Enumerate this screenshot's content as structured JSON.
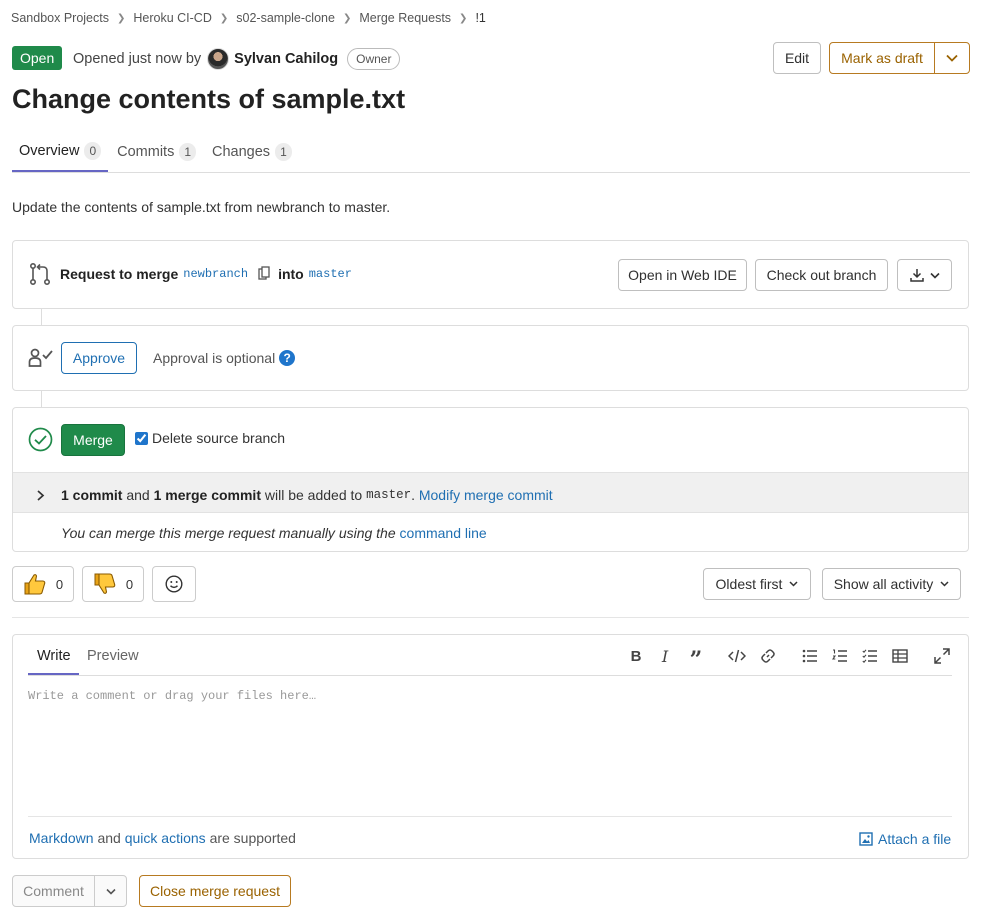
{
  "breadcrumb": [
    "Sandbox Projects",
    "Heroku CI-CD",
    "s02-sample-clone",
    "Merge Requests",
    "!1"
  ],
  "header": {
    "status": "Open",
    "opened_text": "Opened just now by",
    "author": "Sylvan Cahilog",
    "role_badge": "Owner",
    "edit_label": "Edit",
    "draft_label": "Mark as draft",
    "title": "Change contents of sample.txt"
  },
  "tabs": [
    {
      "label": "Overview",
      "count": "0"
    },
    {
      "label": "Commits",
      "count": "1"
    },
    {
      "label": "Changes",
      "count": "1"
    }
  ],
  "description": "Update the contents of sample.txt from newbranch to master.",
  "merge_request": {
    "request_label": "Request to merge",
    "source_branch": "newbranch",
    "into_label": "into",
    "target_branch": "master",
    "web_ide_label": "Open in Web IDE",
    "checkout_label": "Check out branch"
  },
  "approval": {
    "approve_label": "Approve",
    "optional_text": "Approval is optional",
    "help_glyph": "?"
  },
  "merge": {
    "merge_label": "Merge",
    "delete_source_label": "Delete source branch",
    "delete_source_checked": true,
    "commit_count": "1 commit",
    "and_text": "and",
    "merge_commit": "1 merge commit",
    "will_be_added": "will be added to",
    "target": "master",
    "modify_link": "Modify merge commit",
    "manual_text": "You can merge this merge request manually using the",
    "command_line_link": "command line"
  },
  "reactions": {
    "thumbs_up_count": "0",
    "thumbs_down_count": "0"
  },
  "sort": {
    "order_label": "Oldest first",
    "filter_label": "Show all activity"
  },
  "editor": {
    "write_tab": "Write",
    "preview_tab": "Preview",
    "placeholder": "Write a comment or drag your files here…",
    "markdown_link": "Markdown",
    "and_text": "and",
    "quick_actions_link": "quick actions",
    "supported_text": "are supported",
    "attach_label": "Attach a file"
  },
  "footer": {
    "comment_label": "Comment",
    "close_label": "Close merge request"
  },
  "colors": {
    "open_badge": "#1f8a4a",
    "merge_button": "#1f8a4a",
    "link": "#1f6fb2",
    "warning_border": "#b77a21",
    "tab_underline": "#6666c4"
  }
}
